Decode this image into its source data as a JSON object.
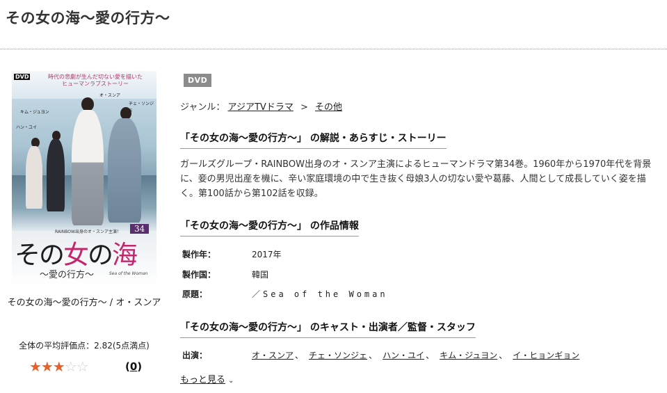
{
  "page_title": "その女の海～愛の行方～",
  "cover": {
    "dvd_tag": "DVD",
    "tagline_1": "時代の悲劇が生んだ切ない愛を描いた",
    "tagline_2": "ヒューマンラブストーリー",
    "names": [
      "オ・スンア",
      "チェ・ソンジェ",
      "キム・ジュヨン",
      "ハン・ユイ"
    ],
    "rainbow_line": "RAINBOW出身のオ・スンア主演！",
    "volume": "34",
    "title_part_1": "その",
    "title_part_2": "女",
    "title_part_3": "の",
    "title_part_4": "海",
    "subtitle": "～愛の行方～",
    "english_title": "Sea of the Woman"
  },
  "item_caption": "その女の海～愛の行方～ / オ・スンア",
  "rating": {
    "average_text": "全体の平均評価点：2.82(5点満点)",
    "stars_on": "★★★",
    "stars_off": "☆☆",
    "review_count": "0",
    "paren_open": "(",
    "paren_close": ")"
  },
  "badge": "DVD",
  "genre": {
    "label": "ジャンル：",
    "primary": "アジアTVドラマ",
    "separator": ">",
    "secondary": "その他"
  },
  "synopsis": {
    "heading": "「その女の海～愛の行方～」 の解説・あらすじ・ストーリー",
    "text": "ガールズグループ・RAINBOW出身のオ・スンア主演によるヒューマンドラマ第34巻。1960年から1970年代を背景に、妾の男児出産を機に、辛い家庭環境の中で生き抜く母娘3人の切ない愛や葛藤、人間として成長していく姿を描く。第100話から第102話を収録。"
  },
  "work_info": {
    "heading": "「その女の海～愛の行方～」 の作品情報",
    "rows": [
      {
        "label": "製作年：",
        "value": "2017年"
      },
      {
        "label": "製作国：",
        "value": "韓国"
      },
      {
        "label": "原題：",
        "value": "／Sea of the Woman"
      }
    ]
  },
  "cast": {
    "heading": "「その女の海～愛の行方～」 のキャスト・出演者／監督・スタッフ",
    "label": "出演：",
    "members": [
      "オ・スンア",
      "チェ・ソンジェ",
      "ハン・ユイ",
      "キム・ジュヨン",
      "イ・ヒョンギョン"
    ],
    "comma": "、",
    "more_label": "もっと見る",
    "more_icon": "⌄"
  },
  "colors": {
    "accent_pink": "#c2266b",
    "star_on": "#e8612b",
    "badge_bg": "#8c8c8c"
  }
}
